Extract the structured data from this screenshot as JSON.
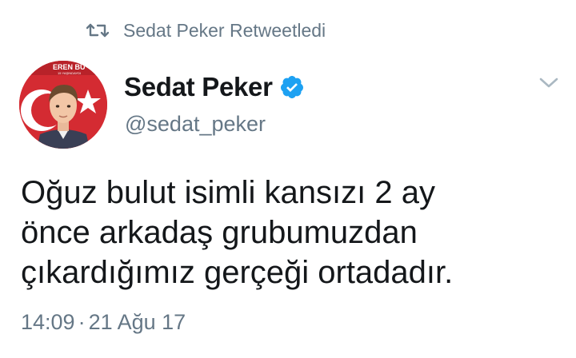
{
  "retweet": {
    "icon": "retweet-icon",
    "label": "Sedat Peker Retweetledi"
  },
  "tweet": {
    "author": {
      "name": "Sedat Peker",
      "handle": "@sedat_peker",
      "verified": true,
      "avatar_icon": "avatar-flag-portrait",
      "avatar_text": "EREN BÜ",
      "avatar_subtext": "15 YAŞINDAYDI"
    },
    "menu_icon": "chevron-down-icon",
    "text": "Oğuz bulut isimli kansızı 2 ay\nönce arkadaş grubumuzdan\nçıkardığımız gerçeği ortadadır.",
    "time": "14:09",
    "separator": "·",
    "date": "21 Ağu 17"
  },
  "colors": {
    "text": "#14171a",
    "muted": "#657786",
    "verified": "#1da1f2",
    "flag_red": "#d42b32"
  }
}
